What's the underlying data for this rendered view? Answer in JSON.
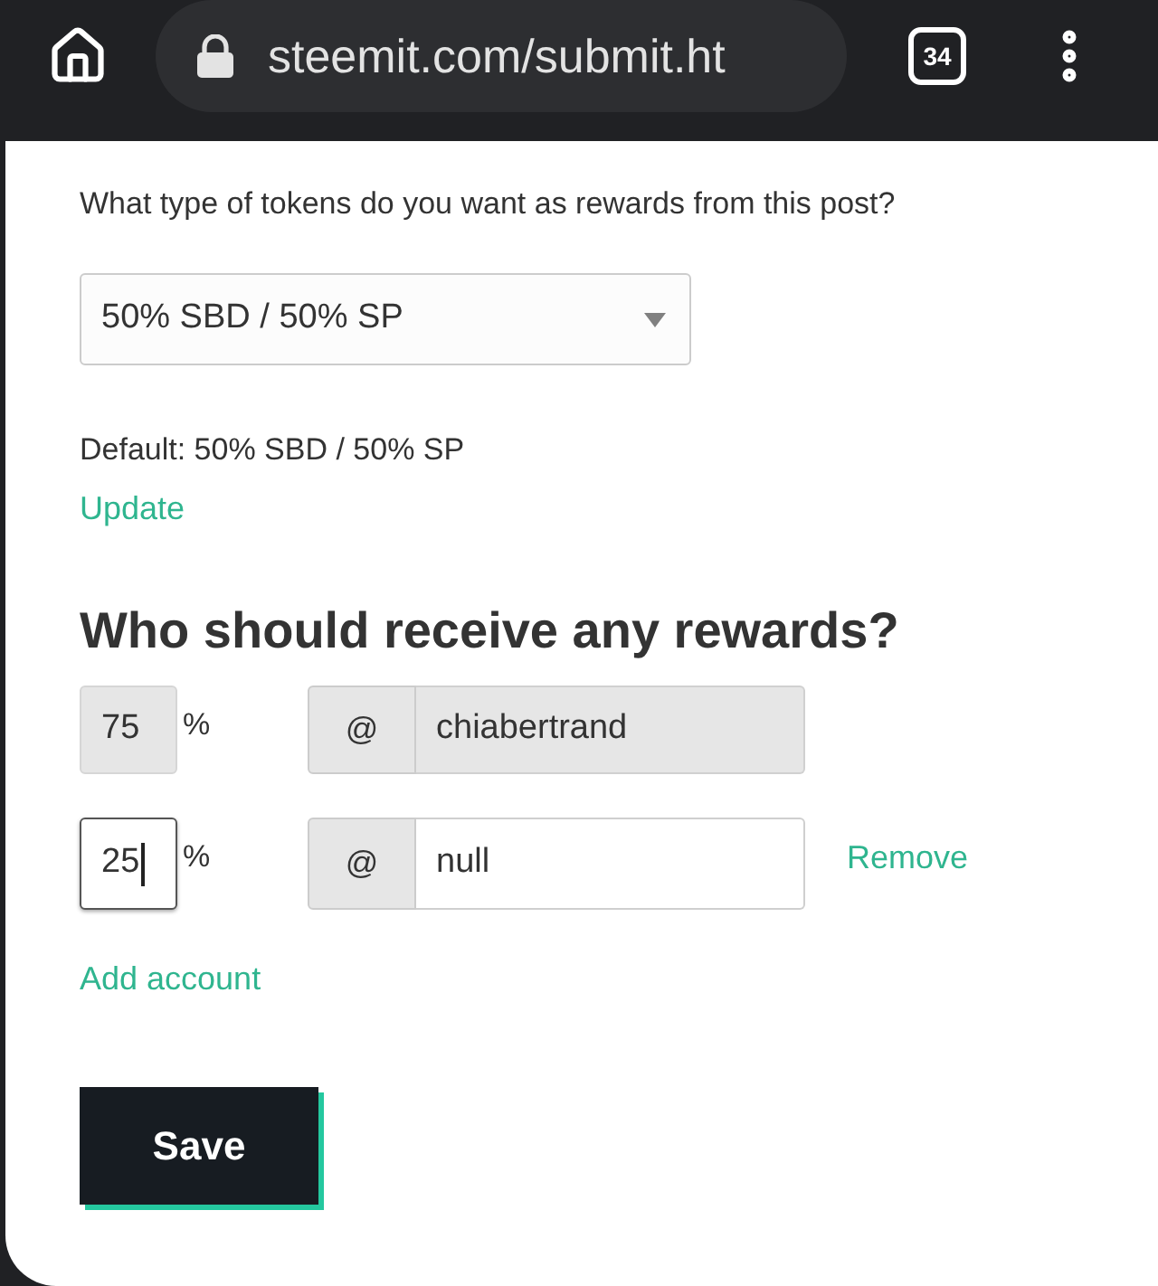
{
  "browser": {
    "url": "steemit.com/submit.ht",
    "tab_count": "34"
  },
  "rewards": {
    "question": "What type of tokens do you want as rewards from this post?",
    "select_value": "50% SBD / 50% SP",
    "default_text": "Default: 50% SBD / 50% SP",
    "update_link": "Update"
  },
  "beneficiaries": {
    "heading": "Who should receive any rewards?",
    "rows": [
      {
        "percent": "75",
        "percent_sign": "%",
        "at_sign": "@",
        "account": "chiabertrand",
        "disabled": true,
        "focused": false
      },
      {
        "percent": "25",
        "percent_sign": "%",
        "at_sign": "@",
        "account": "null",
        "disabled": false,
        "focused": true,
        "remove_link": "Remove"
      }
    ],
    "add_link": "Add account"
  },
  "save_button": "Save"
}
